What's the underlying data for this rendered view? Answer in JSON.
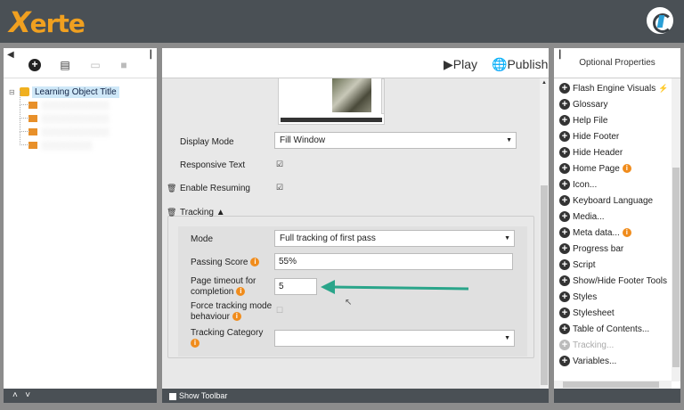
{
  "app": {
    "logo": "Xerte"
  },
  "toolbar_left": {
    "collapse": "‹",
    "pin": "⊣"
  },
  "tree": {
    "root": "Learning Object Title",
    "children": [
      "",
      "",
      "",
      ""
    ]
  },
  "left_footer": {
    "up": "⌃",
    "down": "⌄"
  },
  "center": {
    "play_label": "Play",
    "publish_label": "Publish",
    "display_mode_label": "Display Mode",
    "display_mode_value": "Fill Window",
    "responsive_text_label": "Responsive Text",
    "enable_resuming_label": "Enable Resuming",
    "tracking_label": "Tracking",
    "mode_label": "Mode",
    "mode_value": "Full tracking of first pass",
    "passing_score_label": "Passing Score",
    "passing_score_value": "55%",
    "page_timeout_label_1": "Page timeout for",
    "page_timeout_label_2": "completion",
    "page_timeout_value": "5",
    "force_tracking_label_1": "Force tracking mode",
    "force_tracking_label_2": "behaviour",
    "tracking_category_label": "Tracking Category",
    "tracking_category_value": "",
    "show_toolbar_label": "Show Toolbar"
  },
  "right": {
    "title": "Optional Properties",
    "items": [
      {
        "label": "Flash Engine Visuals",
        "info": false,
        "disabled": false,
        "flash": true
      },
      {
        "label": "Glossary",
        "info": false,
        "disabled": false
      },
      {
        "label": "Help File",
        "info": false,
        "disabled": false
      },
      {
        "label": "Hide Footer",
        "info": false,
        "disabled": false
      },
      {
        "label": "Hide Header",
        "info": false,
        "disabled": false
      },
      {
        "label": "Home Page",
        "info": true,
        "disabled": false
      },
      {
        "label": "Icon...",
        "info": false,
        "disabled": false
      },
      {
        "label": "Keyboard Language",
        "info": false,
        "disabled": false
      },
      {
        "label": "Media...",
        "info": false,
        "disabled": false
      },
      {
        "label": "Meta data...",
        "info": true,
        "disabled": false
      },
      {
        "label": "Progress bar",
        "info": false,
        "disabled": false
      },
      {
        "label": "Script",
        "info": false,
        "disabled": false
      },
      {
        "label": "Show/Hide Footer Tools",
        "info": false,
        "disabled": false
      },
      {
        "label": "Styles",
        "info": false,
        "disabled": false
      },
      {
        "label": "Stylesheet",
        "info": false,
        "disabled": false
      },
      {
        "label": "Table of Contents...",
        "info": false,
        "disabled": false
      },
      {
        "label": "Tracking...",
        "info": false,
        "disabled": true
      },
      {
        "label": "Variables...",
        "info": false,
        "disabled": false
      }
    ]
  },
  "colors": {
    "accent": "#f0a020",
    "arrow": "#2aa58a",
    "header": "#4a5055",
    "info": "#f08c1c"
  },
  "annotation": {
    "type": "arrow",
    "color": "#2aa58a"
  }
}
